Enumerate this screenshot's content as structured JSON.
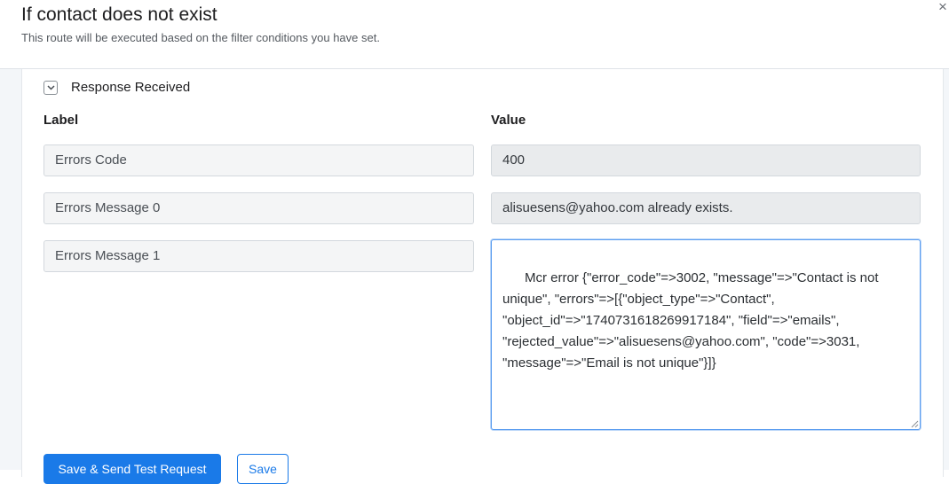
{
  "header": {
    "title": "If contact does not exist",
    "subtitle": "This route will be executed based on the filter conditions you have set.",
    "close_glyph": "×"
  },
  "section": {
    "toggle_label": "Response Received",
    "expanded": true
  },
  "columns": {
    "label": "Label",
    "value": "Value"
  },
  "rows": [
    {
      "label": "Errors Code",
      "value": "400"
    },
    {
      "label": "Errors Message 0",
      "value": "alisuesens@yahoo.com already exists."
    },
    {
      "label": "Errors Message 1",
      "value": "Mcr error {\"error_code\"=>3002, \"message\"=>\"Contact is not unique\", \"errors\"=>[{\"object_type\"=>\"Contact\", \"object_id\"=>\"1740731618269917184\", \"field\"=>\"emails\", \"rejected_value\"=>\"alisuesens@yahoo.com\", \"code\"=>3031, \"message\"=>\"Email is not unique\"}]}"
    }
  ],
  "actions": {
    "save_send": "Save & Send Test Request",
    "save": "Save"
  },
  "colors": {
    "primary": "#1a7ae8",
    "focus_border": "#5b9df0"
  }
}
